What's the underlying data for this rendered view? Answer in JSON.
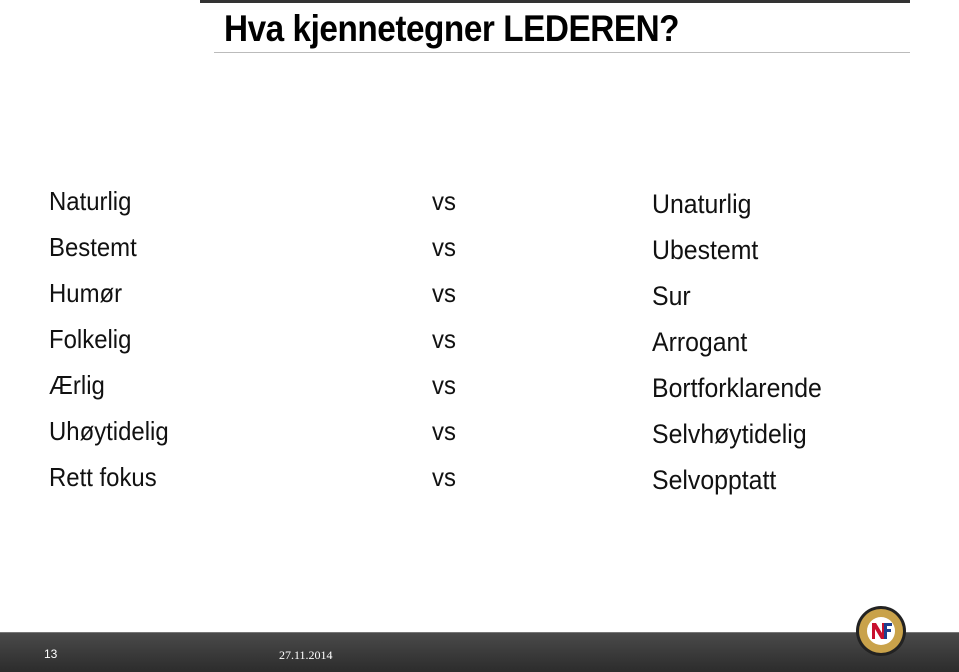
{
  "slide": {
    "title": "Hva kjennetegner LEDEREN?",
    "rows": [
      {
        "left": "Naturlig",
        "vs": "vs",
        "right": "Unaturlig"
      },
      {
        "left": "Bestemt",
        "vs": "vs",
        "right": "Ubestemt"
      },
      {
        "left": "Humør",
        "vs": "vs",
        "right": "Sur"
      },
      {
        "left": "Folkelig",
        "vs": "vs",
        "right": "Arrogant"
      },
      {
        "left": "Ærlig",
        "vs": "vs",
        "right": "Bortforklarende"
      },
      {
        "left": "Uhøytidelig",
        "vs": "vs",
        "right": "Selvhøytidelig"
      },
      {
        "left": "Rett fokus",
        "vs": "vs",
        "right": "Selvopptatt"
      }
    ]
  },
  "footer": {
    "page_number": "13",
    "date": "27.11.2014",
    "logo": "NFF football association logo"
  },
  "colors": {
    "footer": "#3a3a3a",
    "logo_gold": "#c9a24a",
    "logo_red": "#c8102e",
    "logo_blue": "#1d3f8f"
  }
}
